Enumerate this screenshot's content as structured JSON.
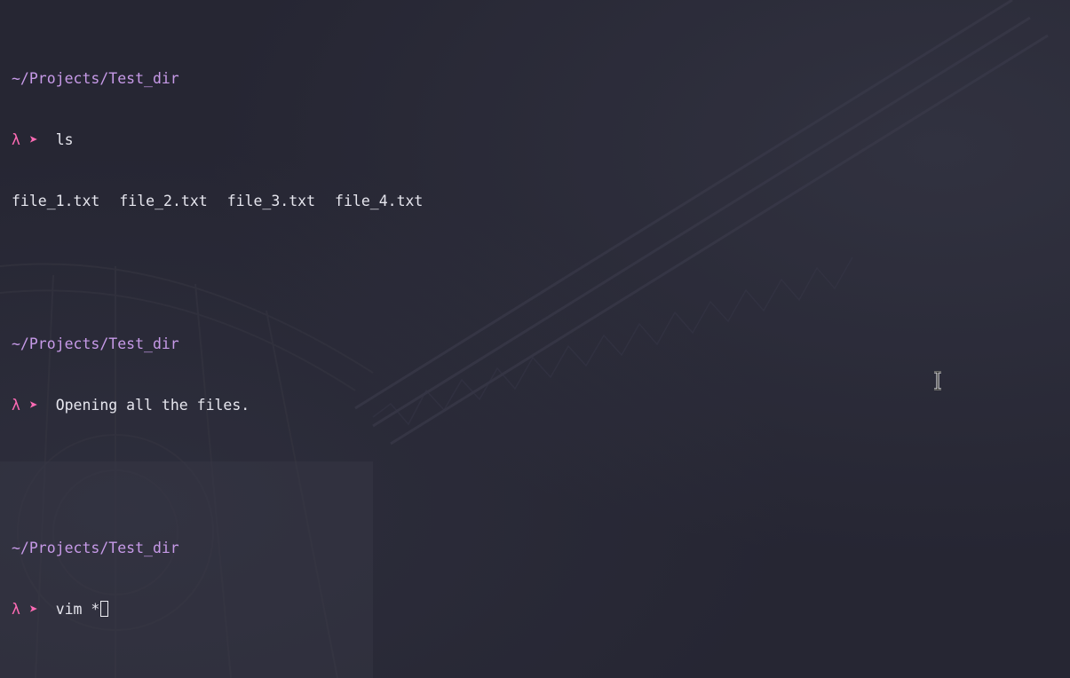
{
  "terminal": {
    "blocks": [
      {
        "path": "~/Projects/Test_dir",
        "prompt_symbol": "λ ➤",
        "command": "ls",
        "output_files": [
          "file_1.txt",
          "file_2.txt",
          "file_3.txt",
          "file_4.txt"
        ]
      },
      {
        "path": "~/Projects/Test_dir",
        "prompt_symbol": "λ ➤",
        "command": "Opening all the files."
      },
      {
        "path": "~/Projects/Test_dir",
        "prompt_symbol": "λ ➤",
        "command": "vim *"
      }
    ]
  },
  "colors": {
    "background": "#262633",
    "path": "#c79ae8",
    "prompt": "#ff6bb5",
    "text": "#e6e6ee"
  },
  "icons": {
    "mouse_cursor": "i-beam-cursor-icon"
  }
}
